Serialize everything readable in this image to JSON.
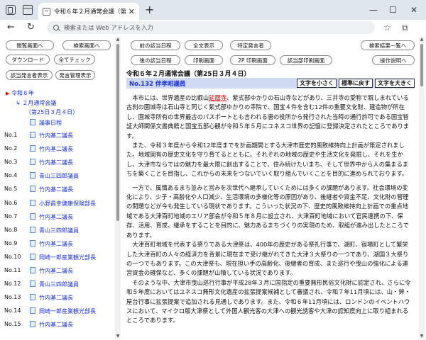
{
  "browser": {
    "tab_title": "令和６年２月通常会議（第25日",
    "url_placeholder": "検索または Web アドレスを入力"
  },
  "left_toolbar": {
    "btn_browse": "閲覧画面へ",
    "btn_search": "検索画面へ",
    "btn_download": "ダウンロード",
    "btn_check_all": "全てチェック",
    "btn_speaker_show": "該当発言者表示",
    "btn_speaker_list": "発言管理表示"
  },
  "tree": {
    "year": "令和６年",
    "session": "２月通常会議",
    "day": "（第25日３月４日）",
    "agenda": "議事日程",
    "rows": [
      {
        "no": "No.1",
        "speaker": "竹内基二議長"
      },
      {
        "no": "No.2",
        "speaker": "竹内基二議長"
      },
      {
        "no": "No.3",
        "speaker": "竹内基二議長"
      },
      {
        "no": "No.4",
        "speaker": "青山三四郎議員"
      },
      {
        "no": "No.5",
        "speaker": "竹内基二議長"
      },
      {
        "no": "No.6",
        "speaker": "小野昌幸健康保険部長"
      },
      {
        "no": "No.7",
        "speaker": "竹内基二議長"
      },
      {
        "no": "No.8",
        "speaker": "青山三四郎議員"
      },
      {
        "no": "No.9",
        "speaker": "竹内基二議長"
      },
      {
        "no": "No.10",
        "speaker": "岡崎一郎産業観光部長"
      },
      {
        "no": "No.11",
        "speaker": "竹内基二議長"
      },
      {
        "no": "No.12",
        "speaker": "青山三四郎議員"
      },
      {
        "no": "No.13",
        "speaker": "竹内基二議長"
      },
      {
        "no": "No.14",
        "speaker": "岡崎一郎産業観光部長"
      },
      {
        "no": "No.15",
        "speaker": "竹内基二議長"
      }
    ]
  },
  "right_toolbar": {
    "btn_prev_doc": "前の該当日程",
    "btn_full": "全文表示",
    "btn_specific": "特定発言者",
    "btn_result_list": "検索結果一覧へ",
    "btn_next_doc": "後の該当日程",
    "btn_print": "印刷画面",
    "btn_print_2p": "2P 印刷画面",
    "btn_print_hit": "該当部印刷画面",
    "btn_help": "操作説明へ"
  },
  "document": {
    "meeting_title": "令和６年２月通常会議（第25日３月４日）",
    "speaker_header": "No.132 伴孝昭議員",
    "font_smaller": "文字を小さく",
    "font_normal": "標準に戻す",
    "font_larger": "文字を大きく",
    "p1_before": "本市には、世界遺産の比叡山",
    "p1_highlight": "延暦寺",
    "p1_after": "、紫式部ゆかりの石山寺などがあり、三井寺の愛称で親しまれている古刹の園城寺は石山寺と同じく紫式部ゆかりの寺院で、国宝４件を含む12件の重要文化財、建造物が所在し、園城寺所有の世界最古のパスポートとも言われる唐の役所から発行された当時の通行許可である国宝智証大師関係文書典籍と国宝五部心観が令和５年５月にユネスコ世界の記憶に登録決定されたところであります。",
    "p2": "また、令和３年度から令和12年度までを計画期間とする大津市歴史的風致維持向上計画が策定されました。地域固有の歴史文化を守り育てるとともに、それぞれの地域の歴史や生活文化を発掘し、それを生かし、大津市ならではの魅力を最大限に創出することで、住み続けたいまち、そして世界中から人の集まるまちを築くことを目指し、これからの未来をつないでいく取り組んでいくことを目的に進められております。",
    "p3": "一方で、風情あるまち並みと営みを次世代へ継承していくためには多くの課題があります。社会環境の変化により、少子・高齢化や人口減少、生活環境の多様化等の原因があり、後継者や資金不足、文化財の管理の問題などが今も発生している現状であります。こういった状況の下、歴史的風致維持向上計画での重点地域である大津百町地域のエリア部会が令和５年８月に設立され、大津百町地域において官民連携の下、保存、活用、育成、継承をすることを目的に、魅力あるまちづくりの実現のため、取組が進み出したところであります。",
    "p4": "大津百町地域を代表する祭りである大津祭は、400年の歴史がある祭礼行事で、湖町、宿場町として繁栄した大津百町の人々の経済力を背景に現在まで受け継がれてきた大津３大祭りの一つであり、湖国３大祭りの一つでもあります。この大津祭も、現在担い手の高齢化、後継者の育成、また巡行や曳山の強化による運営資金の確保など、多くの課題が山積している状況であります。",
    "p5": "そのような中、大津市曳山巡行行事が平成28年３月に国指定の重要無形民俗文化財に認定され、さらに令和５年度においてはユネスコ無形文化遺産の拡張提案候補として審議され、令和７年11月頃には、山・鉾・屋台行事に拡張提案で追加される見通しであります。また、令和６年11月頃には、ロンドンのイベントハウスにおいて、マイクロ版大津祭として外国人観光客の大津への観光誘客や大津の認知度向上に取り組まれるところであります。"
  }
}
